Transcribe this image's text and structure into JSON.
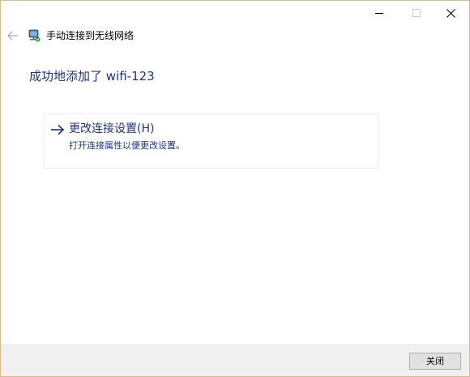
{
  "window": {
    "title": "手动连接到无线网络"
  },
  "icons": {
    "minimize": "minimize-icon",
    "maximize": "maximize-icon",
    "close": "close-icon",
    "back": "back-arrow-icon",
    "network": "network-icon",
    "command_arrow": "arrow-right-icon"
  },
  "main": {
    "heading": "成功地添加了 wifi-123"
  },
  "command_link": {
    "title": "更改连接设置(H)",
    "description": "打开连接属性以便更改设置。"
  },
  "footer": {
    "close_label": "关闭"
  },
  "colors": {
    "accent_text": "#1e3287",
    "window_border": "#d9b98f",
    "footer_bg": "#f0f0f0",
    "button_bg": "#e1e1e1",
    "button_border": "#adadad"
  }
}
